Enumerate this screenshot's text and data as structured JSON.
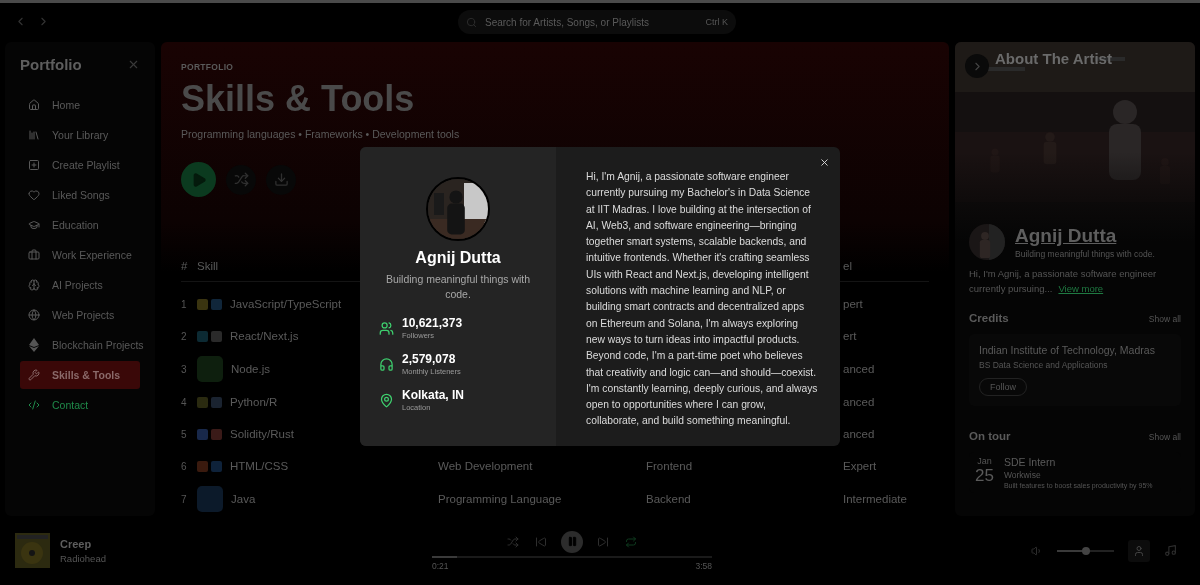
{
  "topbar": {
    "search": {
      "placeholder": "Search for Artists, Songs, or Playlists",
      "shortcut": "Ctrl K"
    }
  },
  "sidebar": {
    "title": "Portfolio",
    "items": [
      {
        "label": "Home",
        "selected": false,
        "highlight": false
      },
      {
        "label": "Your Library",
        "selected": false,
        "highlight": false
      },
      {
        "label": "Create Playlist",
        "selected": false,
        "highlight": false
      },
      {
        "label": "Liked Songs",
        "selected": false,
        "highlight": false
      },
      {
        "label": "Education",
        "selected": false,
        "highlight": false
      },
      {
        "label": "Work Experience",
        "selected": false,
        "highlight": false
      },
      {
        "label": "AI Projects",
        "selected": false,
        "highlight": false
      },
      {
        "label": "Web Projects",
        "selected": false,
        "highlight": false
      },
      {
        "label": "Blockchain Projects",
        "selected": false,
        "highlight": false
      },
      {
        "label": "Skills & Tools",
        "selected": true,
        "highlight": false
      },
      {
        "label": "Contact",
        "selected": false,
        "highlight": true
      }
    ]
  },
  "header": {
    "eyebrow": "PORTFOLIO",
    "title": "Skills & Tools",
    "subtitle": "Programming languages • Frameworks • Development tools"
  },
  "table": {
    "columns": [
      "#",
      "Skill",
      "el"
    ],
    "rows": [
      {
        "index": "1",
        "skill": "JavaScript/TypeScript",
        "logos": [
          {
            "color": "#3a3410"
          },
          {
            "color": "#10263a"
          }
        ],
        "level": "pert"
      },
      {
        "index": "2",
        "skill": "React/Next.js",
        "logos": [
          {
            "color": "#0c2a33"
          },
          {
            "color": "#2a2a2a"
          }
        ],
        "level": "ert"
      },
      {
        "index": "3",
        "skill": "Node.js",
        "logos": [
          {
            "color": "#0e1f0e"
          }
        ],
        "level": "anced"
      },
      {
        "index": "4",
        "skill": "Python/R",
        "logos": [
          {
            "color": "#2a2a10"
          },
          {
            "color": "#1a2330"
          }
        ],
        "level": "anced"
      },
      {
        "index": "5",
        "skill": "Solidity/Rust",
        "logos": [
          {
            "color": "#18284a"
          },
          {
            "color": "#3a1a18"
          }
        ],
        "level": "anced"
      },
      {
        "index": "6",
        "skill": "HTML/CSS",
        "logos": [
          {
            "color": "#3a1a0e"
          },
          {
            "color": "#0e223a"
          }
        ],
        "category": "Web Development",
        "type": "Frontend",
        "level": "Expert"
      },
      {
        "index": "7",
        "skill": "Java",
        "logos": [
          {
            "color": "#0c1a2a"
          }
        ],
        "category": "Programming Language",
        "type": "Backend",
        "level": "Intermediate"
      }
    ]
  },
  "artist_panel": {
    "title": "About The Artist",
    "name": "Agnij Dutta",
    "tagline": "Building meaningful things with code.",
    "bio": "Hi, I'm Agnij, a passionate software engineer currently pursuing...",
    "more": "View more",
    "credits": {
      "title": "Credits",
      "show_all": "Show all",
      "items": [
        {
          "name": "Indian Institute of Technology, Madras",
          "detail": "BS Data Science and Applications",
          "action": "Follow"
        }
      ]
    },
    "tour": {
      "title": "On tour",
      "show_all": "Show all",
      "items": [
        {
          "month": "Jan",
          "day": "25",
          "role": "SDE Intern",
          "company": "Workwise",
          "note": "Built features to boost sales productivity by 95%"
        }
      ]
    }
  },
  "player": {
    "title": "Creep",
    "artist": "Radiohead",
    "elapsed": "0:21",
    "duration": "3:58",
    "level": 0.09,
    "volume": {
      "level": 0.5
    }
  },
  "modal": {
    "name": "Agnij Dutta",
    "tagline": "Building meaningful things with code.",
    "stats": [
      {
        "value": "10,621,373",
        "label": "Followers"
      },
      {
        "value": "2,579,078",
        "label": "Monthly Listeners"
      },
      {
        "value": "Kolkata, IN",
        "label": "Location"
      }
    ],
    "bio": "Hi, I'm Agnij, a passionate software engineer currently pursuing my Bachelor's in Data Science at IIT Madras. I love building at the intersection of AI, Web3, and software engineering—bringing together smart systems, scalable backends, and intuitive frontends. Whether it's crafting seamless UIs with React and Next.js, developing intelligent solutions with machine learning and NLP, or building smart contracts and decentralized apps on Ethereum and Solana, I'm always exploring new ways to turn ideas into impactful products. Beyond code, I'm a part-time poet who believes that creativity and logic can—and should—coexist. I'm constantly learning, deeply curious, and always open to opportunities where I can grow, collaborate, and build something meaningful."
  }
}
